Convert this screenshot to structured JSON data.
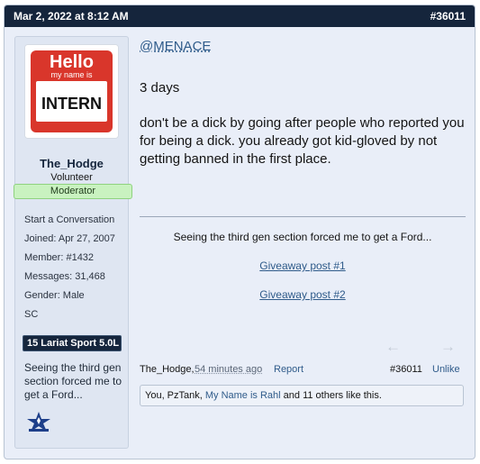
{
  "header": {
    "date": "Mar 2, 2022 at 8:12 AM",
    "post_number": "#36011"
  },
  "user": {
    "avatar_text": {
      "hello": "Hello",
      "my_name_is": "my name is",
      "name": "INTERN"
    },
    "username": "The_Hodge",
    "title": "Volunteer",
    "banner": "Moderator",
    "extras": [
      "Start a Conversation",
      "Joined:  Apr 27, 2007",
      "Member:  #1432",
      "Messages:  31,468",
      "Gender:  Male",
      "SC"
    ],
    "vehicle": "15 Lariat Sport 5.0L",
    "signature_snippet": "Seeing the third gen section forced me to get a Ford..."
  },
  "post": {
    "mention": "@MENACE",
    "paragraph1": "3 days",
    "paragraph2": "don't be a dick by going after people who reported you for being a dick. you already got kid-gloved by not getting banned in the first place."
  },
  "signature": {
    "text": "Seeing the third gen section forced me to get a Ford...",
    "link1": "Giveaway post #1",
    "link2": "Giveaway post #2"
  },
  "footer": {
    "author": "The_Hodge,",
    "time": "54 minutes ago",
    "report": "Report",
    "post_number": "#36011",
    "unlike": "Unlike"
  },
  "likes": {
    "prefix": "You, PzTank, ",
    "name": "My Name is Rahl",
    "suffix": " and 11 others like this."
  },
  "icons": {
    "prev": "arrow-left-icon",
    "next": "arrow-right-icon",
    "logo": "air-force-logo-icon"
  },
  "colors": {
    "header_bg": "#15253c",
    "link": "#2f5b8a",
    "moderator_banner": "#c9f2c0",
    "post_bg": "#e9eef8"
  }
}
